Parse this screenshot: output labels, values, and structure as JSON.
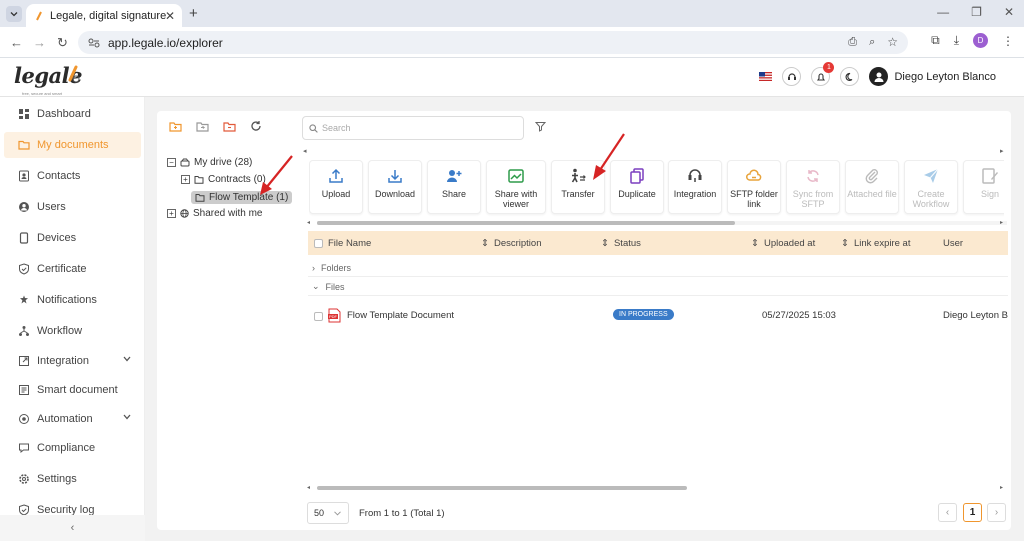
{
  "browser": {
    "tab_title": "Legale, digital signature",
    "url": "app.legale.io/explorer",
    "profile_initial": "D"
  },
  "header": {
    "logo_text": "legale",
    "logo_tagline": "free, secure and smart",
    "notification_count": "1",
    "user_name": "Diego Leyton Blanco"
  },
  "sidebar": {
    "items": [
      {
        "label": "Dashboard",
        "icon": "dashboard-icon"
      },
      {
        "label": "My documents",
        "icon": "folder-icon",
        "active": true
      },
      {
        "label": "Contacts",
        "icon": "contacts-icon"
      },
      {
        "label": "Users",
        "icon": "user-icon"
      },
      {
        "label": "Devices",
        "icon": "device-icon"
      },
      {
        "label": "Certificate",
        "icon": "shield-icon"
      },
      {
        "label": "Notifications",
        "icon": "bell-icon"
      },
      {
        "label": "Workflow",
        "icon": "workflow-icon"
      },
      {
        "label": "Integration",
        "icon": "integration-icon",
        "expandable": true
      },
      {
        "label": "Smart document",
        "icon": "smart-doc-icon"
      },
      {
        "label": "Automation",
        "icon": "automation-icon",
        "expandable": true
      },
      {
        "label": "Compliance",
        "icon": "compliance-icon"
      },
      {
        "label": "Settings",
        "icon": "gear-icon"
      },
      {
        "label": "Security log",
        "icon": "security-icon"
      }
    ],
    "collapse_glyph": "‹"
  },
  "search": {
    "placeholder": "Search"
  },
  "tree": {
    "my_drive": "My drive (28)",
    "contracts": "Contracts (0)",
    "flow_template": "Flow Template (1)",
    "shared": "Shared with me"
  },
  "toolbar": [
    {
      "label": "Upload",
      "enabled": true
    },
    {
      "label": "Download",
      "enabled": true
    },
    {
      "label": "Share",
      "enabled": true
    },
    {
      "label": "Share with viewer",
      "enabled": true
    },
    {
      "label": "Transfer",
      "enabled": true
    },
    {
      "label": "Duplicate",
      "enabled": true
    },
    {
      "label": "Integration",
      "enabled": true
    },
    {
      "label": "SFTP folder link",
      "enabled": true
    },
    {
      "label": "Sync from SFTP",
      "enabled": false
    },
    {
      "label": "Attached file",
      "enabled": false
    },
    {
      "label": "Create Workflow",
      "enabled": false
    },
    {
      "label": "Sign",
      "enabled": false
    }
  ],
  "table": {
    "columns": [
      "File Name",
      "Description",
      "Status",
      "Uploaded at",
      "Link expire at",
      "User"
    ],
    "groups": {
      "folders": "Folders",
      "files": "Files"
    },
    "rows": [
      {
        "name": "Flow Template Document",
        "status": "IN PROGRESS",
        "uploaded": "05/27/2025 15:03",
        "user": "Diego Leyton Bla"
      }
    ]
  },
  "pager": {
    "page_size": "50",
    "info": "From 1 to 1 (Total 1)",
    "current_page": "1"
  },
  "colors": {
    "accent": "#f0962e",
    "status_blue": "#3a7bc8",
    "arrow_red": "#d62424"
  }
}
